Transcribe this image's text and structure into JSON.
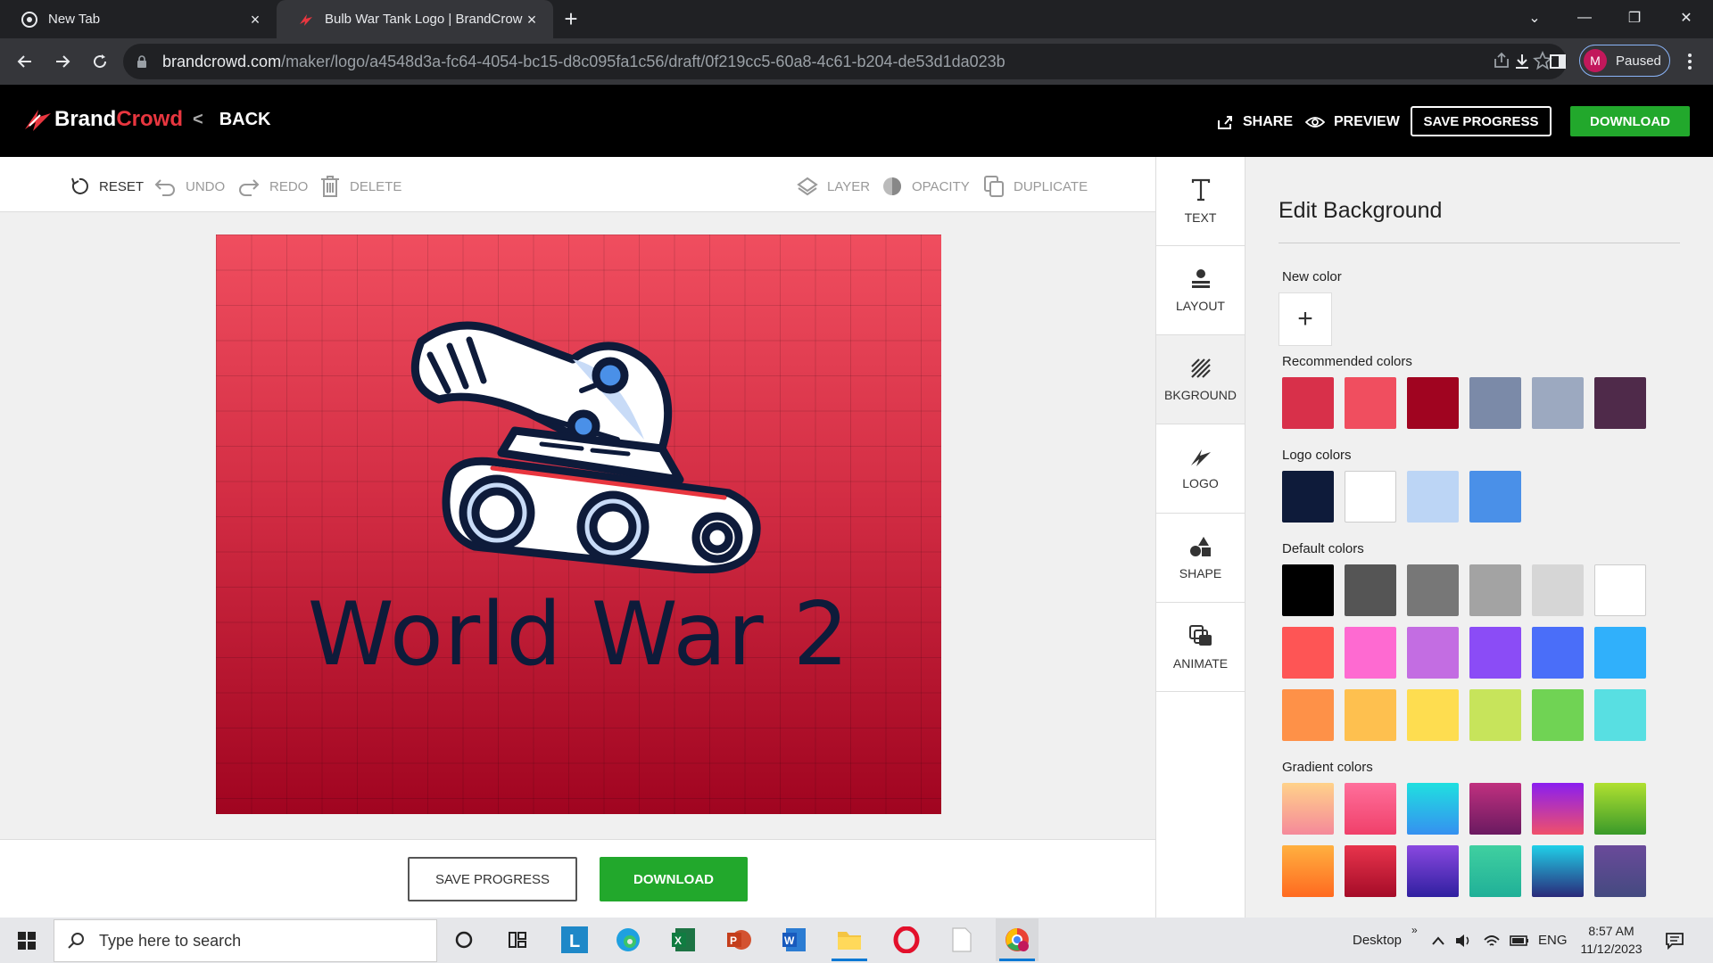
{
  "browser": {
    "tabs": [
      {
        "title": "New Tab",
        "active": false
      },
      {
        "title": "Bulb War Tank Logo | BrandCrow",
        "active": true
      }
    ],
    "url_host": "brandcrowd.com",
    "url_path": "/maker/logo/a4548d3a-fc64-4054-bc15-d8c095fa1c56/draft/0f219cc5-60a8-4c61-b204-de53d1da023b",
    "profile_initial": "M",
    "profile_status": "Paused"
  },
  "header": {
    "brand_a": "Brand",
    "brand_b": "Crowd",
    "back_label": "BACK",
    "share_label": "SHARE",
    "preview_label": "PREVIEW",
    "save_label": "SAVE PROGRESS",
    "download_label": "DOWNLOAD"
  },
  "toolbar": {
    "reset": "RESET",
    "undo": "UNDO",
    "redo": "REDO",
    "delete": "DELETE",
    "layer": "LAYER",
    "opacity": "OPACITY",
    "duplicate": "DUPLICATE"
  },
  "canvas": {
    "logo_text": "World War 2"
  },
  "bottom": {
    "save_label": "SAVE PROGRESS",
    "download_label": "DOWNLOAD"
  },
  "rail": {
    "items": [
      {
        "label": "TEXT",
        "icon": "text-icon"
      },
      {
        "label": "LAYOUT",
        "icon": "layout-icon"
      },
      {
        "label": "BKGROUND",
        "icon": "background-icon"
      },
      {
        "label": "LOGO",
        "icon": "logo-icon"
      },
      {
        "label": "SHAPE",
        "icon": "shape-icon"
      },
      {
        "label": "ANIMATE",
        "icon": "animate-icon"
      }
    ]
  },
  "panel": {
    "title": "Edit Background",
    "new_color_label": "New color",
    "recommended_label": "Recommended colors",
    "logo_colors_label": "Logo colors",
    "default_label": "Default colors",
    "gradient_label": "Gradient colors",
    "recommended": [
      "#d8304a",
      "#f04e5f",
      "#a00420",
      "#7b8aa8",
      "#9ca9c0",
      "#4f2a4a"
    ],
    "logo_colors": [
      "#0e1b3a",
      "#ffffff",
      "#bcd5f5",
      "#4a90e8"
    ],
    "default_colors": [
      [
        "#000000",
        "#555555",
        "#777777",
        "#a3a3a3",
        "#d6d6d6",
        "#ffffff"
      ],
      [
        "#fe5555",
        "#fe6ad1",
        "#c36de2",
        "#8b4cf6",
        "#4a6ef9",
        "#30b0fb"
      ],
      [
        "#fe9148",
        "#fec04f",
        "#fedd50",
        "#c7e45b",
        "#70d354",
        "#58dfe2"
      ]
    ],
    "gradient_colors": [
      [
        [
          "#ffd28a",
          "#f5899a"
        ],
        [
          "#ff6f9b",
          "#f0406a"
        ],
        [
          "#20e0e0",
          "#3590f0"
        ],
        [
          "#c0307f",
          "#6a1a60"
        ],
        [
          "#8a1ef0",
          "#f0506a"
        ],
        [
          "#b0e030",
          "#3a9a2a"
        ]
      ],
      [
        [
          "#ffb040",
          "#ff6a20"
        ],
        [
          "#e8344c",
          "#a50c28"
        ],
        [
          "#8a48e0",
          "#3020a0"
        ],
        [
          "#40d0a0",
          "#20b098"
        ],
        [
          "#20d0e8",
          "#2a2a7a"
        ],
        [
          "#6a4a9a",
          "#444a80"
        ]
      ]
    ]
  },
  "taskbar": {
    "search_placeholder": "Type here to search",
    "desktop_label": "Desktop",
    "lang": "ENG",
    "time": "8:57 AM",
    "date": "11/12/2023"
  }
}
